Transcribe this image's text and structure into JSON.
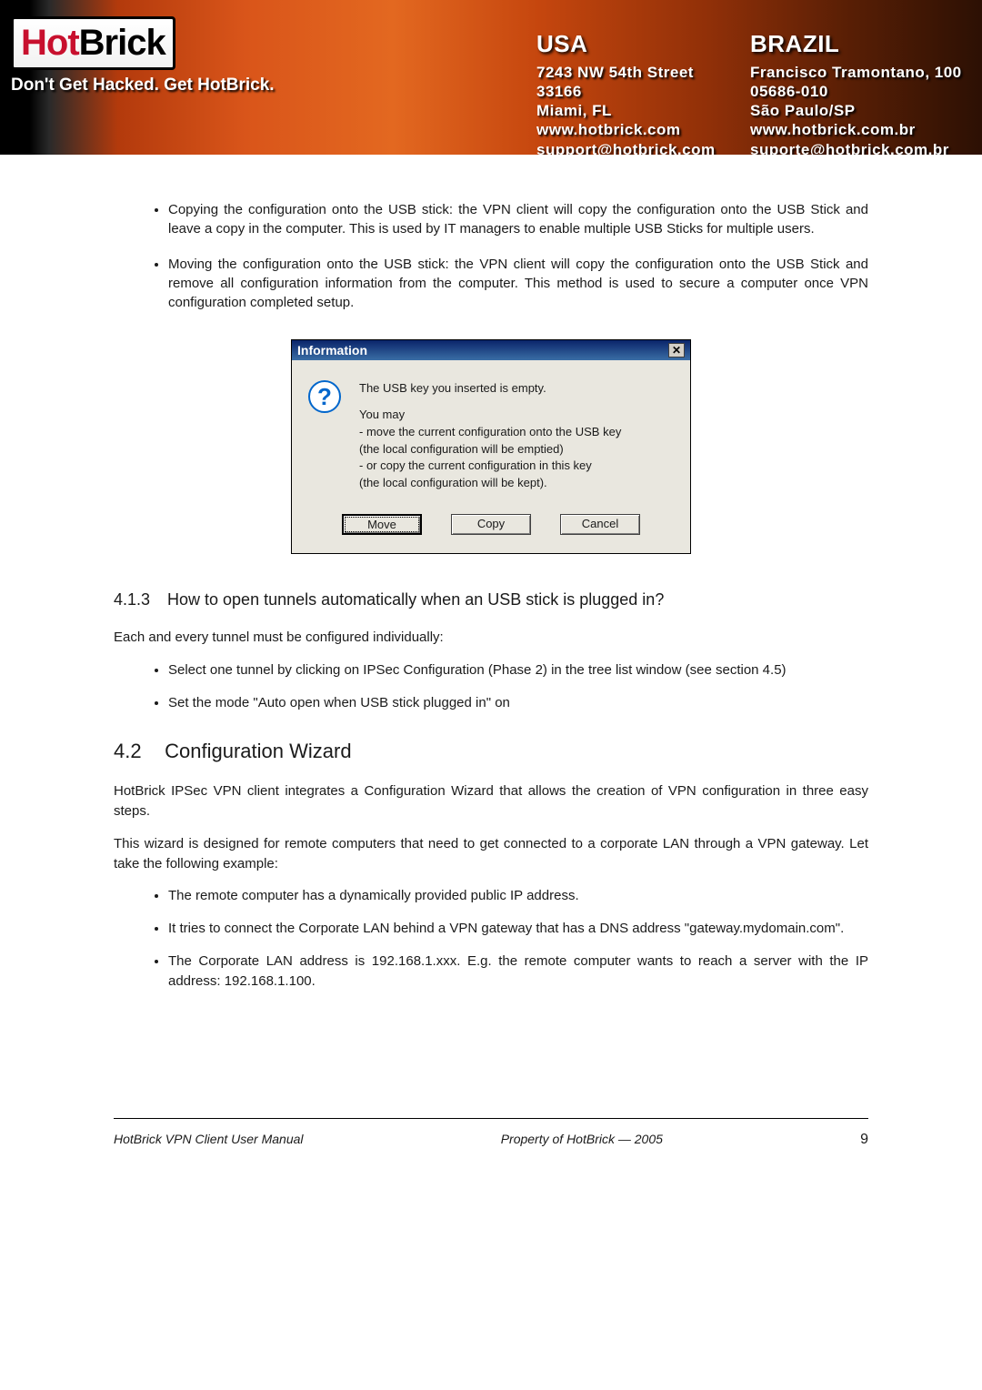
{
  "header": {
    "logo": {
      "hot": "Hot",
      "brick": "Brick"
    },
    "tagline": "Don't Get Hacked. Get HotBrick.",
    "usa": {
      "country": "USA",
      "l1": "7243 NW 54th Street",
      "l2": "33166",
      "l3": "Miami, FL",
      "l4": "www.hotbrick.com",
      "l5": "support@hotbrick.com"
    },
    "brazil": {
      "country": "BRAZIL",
      "l1": "Francisco Tramontano, 100",
      "l2": "05686-010",
      "l3": "São Paulo/SP",
      "l4": "www.hotbrick.com.br",
      "l5": "suporte@hotbrick.com.br"
    }
  },
  "bullets_top": {
    "b1_lead": "Copying",
    "b1_rest": " the configuration onto the USB stick: the VPN client will copy the configuration onto the USB Stick and leave a copy in the computer. This is used by IT managers to enable multiple USB Sticks for multiple users.",
    "b2_lead": "Moving",
    "b2_rest": " the configuration onto the USB stick: the VPN client will copy the configuration onto the USB Stick and remove all configuration information from the computer. This method is used to secure a computer once VPN configuration completed setup."
  },
  "dialog": {
    "title": "Information",
    "line1": "The USB key you inserted is empty.",
    "line2": "You may",
    "line3": "- move the current configuration onto the USB key",
    "line4": "  (the local configuration will be emptied)",
    "line5": "- or copy the current configuration in this key",
    "line6": "  (the local configuration will be kept).",
    "btn_move": "Move",
    "btn_copy": "Copy",
    "btn_cancel": "Cancel"
  },
  "sec_413": {
    "num": "4.1.3",
    "title": "How to open tunnels automatically when an USB stick is plugged in?",
    "intro": "Each and every tunnel must be configured individually:",
    "li1": "Select one tunnel by clicking on IPSec Configuration (Phase 2) in the tree list window (see section 4.5)",
    "li2": "Set the mode \"Auto open when USB stick plugged in\" on"
  },
  "sec_42": {
    "num": "4.2",
    "title": "Configuration Wizard",
    "p1": "HotBrick IPSec VPN client integrates a Configuration Wizard that allows the creation of VPN configuration in three easy steps.",
    "p2": "This wizard is designed for remote computers that need to get connected to a corporate LAN through a VPN gateway. Let take the following example:",
    "li1": "The remote computer has a dynamically provided public IP address.",
    "li2": "It tries to connect the Corporate LAN behind a VPN gateway that has a DNS address \"gateway.mydomain.com\".",
    "li3": "The Corporate LAN address is 192.168.1.xxx. E.g. the remote computer wants to reach a server with the IP address: 192.168.1.100."
  },
  "footer": {
    "left": "HotBrick VPN Client User Manual",
    "right": "Property of HotBrick — 2005",
    "page": "9"
  }
}
